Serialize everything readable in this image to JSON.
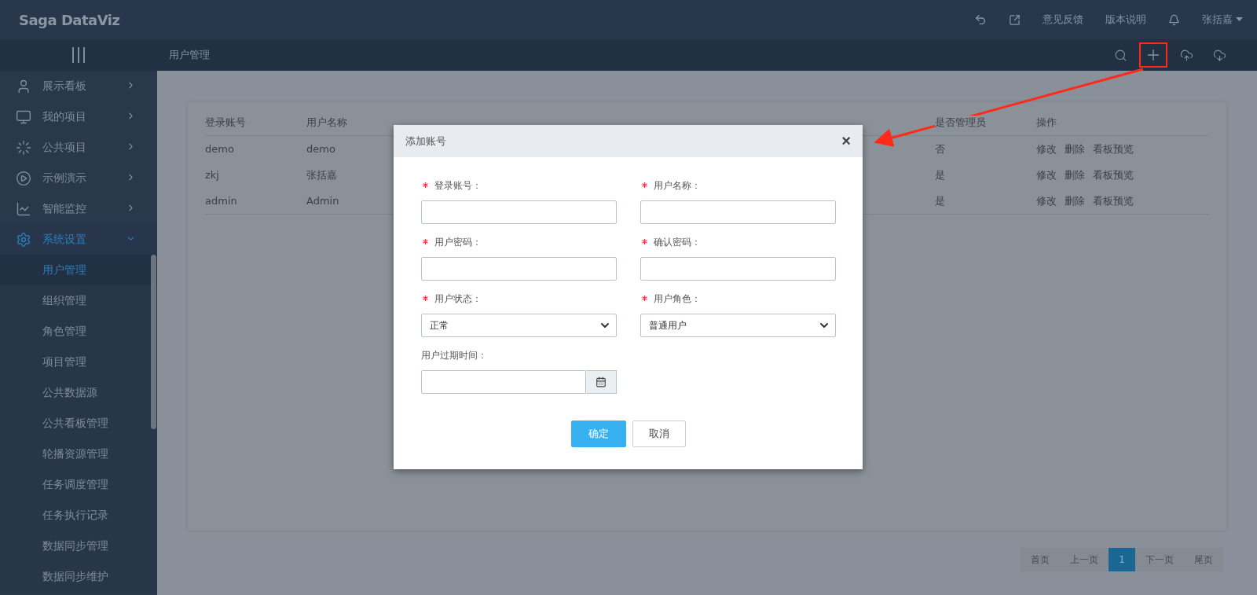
{
  "header": {
    "logo": "Saga DataViz",
    "links": [
      "意见反馈",
      "版本说明"
    ],
    "user": "张括嘉"
  },
  "subbar": {
    "title": "用户管理",
    "actions": [
      {
        "kind": "search",
        "highlighted": false
      },
      {
        "kind": "add",
        "highlighted": true
      },
      {
        "kind": "upload",
        "highlighted": false
      },
      {
        "kind": "download",
        "highlighted": false
      }
    ]
  },
  "sidebar": {
    "items": [
      {
        "label": "展示看板",
        "expanded": false,
        "selected": false
      },
      {
        "label": "我的项目",
        "expanded": false,
        "selected": false
      },
      {
        "label": "公共项目",
        "expanded": false,
        "selected": false
      },
      {
        "label": "示例演示",
        "expanded": false,
        "selected": false
      },
      {
        "label": "智能监控",
        "expanded": false,
        "selected": false
      },
      {
        "label": "系统设置",
        "expanded": true,
        "selected": true,
        "children": [
          {
            "label": "用户管理",
            "selected": true
          },
          {
            "label": "组织管理",
            "selected": false
          },
          {
            "label": "角色管理",
            "selected": false
          },
          {
            "label": "项目管理",
            "selected": false
          },
          {
            "label": "公共数据源",
            "selected": false
          },
          {
            "label": "公共看板管理",
            "selected": false
          },
          {
            "label": "轮播资源管理",
            "selected": false
          },
          {
            "label": "任务调度管理",
            "selected": false
          },
          {
            "label": "任务执行记录",
            "selected": false
          },
          {
            "label": "数据同步管理",
            "selected": false
          },
          {
            "label": "数据同步维护",
            "selected": false
          }
        ]
      }
    ]
  },
  "table": {
    "columns": [
      "登录账号",
      "用户名称",
      "是否管理员",
      "操作"
    ],
    "rows": [
      {
        "account": "demo",
        "name": "demo",
        "admin": "否",
        "actions": [
          "修改",
          "删除",
          "看板预览"
        ]
      },
      {
        "account": "zkj",
        "name": "张括嘉",
        "admin": "是",
        "actions": [
          "修改",
          "删除",
          "看板预览"
        ]
      },
      {
        "account": "admin",
        "name": "Admin",
        "admin": "是",
        "actions": [
          "修改",
          "删除",
          "看板预览"
        ]
      }
    ]
  },
  "pagination": [
    {
      "label": "首页",
      "selected": false
    },
    {
      "label": "上一页",
      "selected": false
    },
    {
      "label": "1",
      "selected": true
    },
    {
      "label": "下一页",
      "selected": false
    },
    {
      "label": "尾页",
      "selected": false
    }
  ],
  "dialog": {
    "title": "添加账号",
    "close": "×",
    "fields": [
      {
        "kind": "text",
        "label": "登录账号：",
        "required": true
      },
      {
        "kind": "text",
        "label": "用户名称：",
        "required": true
      },
      {
        "kind": "password",
        "label": "用户密码：",
        "required": true
      },
      {
        "kind": "password",
        "label": "确认密码：",
        "required": true
      },
      {
        "kind": "select",
        "label": "用户状态：",
        "required": true,
        "value": "正常"
      },
      {
        "kind": "select",
        "label": "用户角色：",
        "required": true,
        "value": "普通用户"
      },
      {
        "kind": "date",
        "label": "用户过期时间：",
        "required": false
      }
    ],
    "buttons": [
      {
        "label": "确定",
        "kind": "primary"
      },
      {
        "label": "取消",
        "kind": "default"
      }
    ]
  }
}
